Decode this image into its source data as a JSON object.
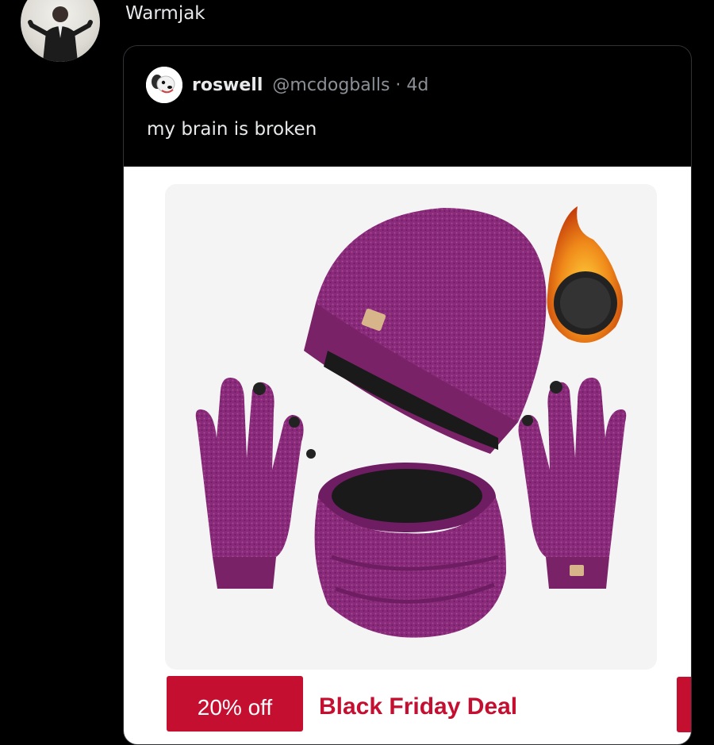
{
  "post": {
    "author_name": "Warmjak",
    "avatar_icon": "person-avatar-icon"
  },
  "quote": {
    "display_name": "roswell",
    "handle": "@mcdogballs · 4d",
    "text": "my brain is broken",
    "avatar_icon": "dog-avatar-icon"
  },
  "product": {
    "image_icon": "beanie-scarf-gloves-set-icon",
    "discount_label": "20% off",
    "deal_label": "Black Friday Deal",
    "colors": {
      "knit": "#8a2a7a",
      "badge": "#c50f31"
    }
  }
}
